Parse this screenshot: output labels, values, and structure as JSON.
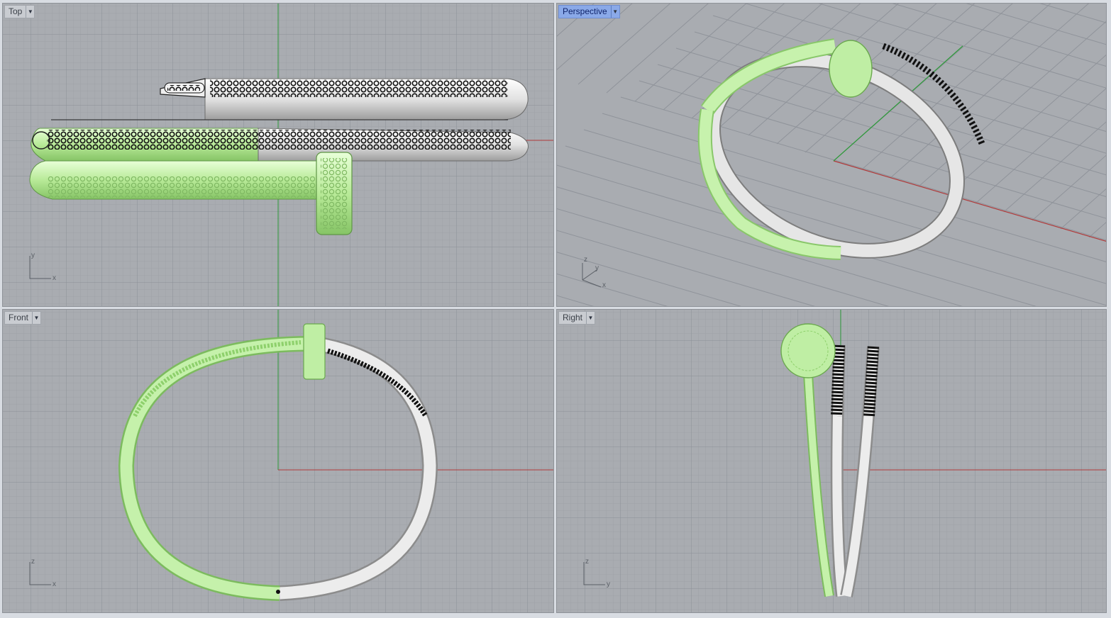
{
  "viewports": {
    "top": {
      "label": "Top",
      "active": false,
      "axis": {
        "vertical": "y",
        "horizontal": "x"
      }
    },
    "perspective": {
      "label": "Perspective",
      "active": true,
      "axis": {
        "vertical": "z",
        "depth": "y",
        "horizontal": "x"
      }
    },
    "front": {
      "label": "Front",
      "active": false,
      "axis": {
        "vertical": "z",
        "horizontal": "x"
      }
    },
    "right": {
      "label": "Right",
      "active": false,
      "axis": {
        "vertical": "z",
        "horizontal": "y"
      }
    }
  },
  "icons": {
    "viewport_menu": "dropdown-arrow-icon"
  },
  "colors": {
    "viewport_bg": "#a9acb1",
    "grid_minor": "#9ea2a8",
    "grid_major": "#8b9096",
    "x_axis": "#b03a3a",
    "y_axis": "#2e9a3a",
    "selected_green": "#c2f0a8",
    "metal_silver": "#e4e4e4",
    "pave_black": "#1a1a1a",
    "active_tab": "#8aa9e8"
  }
}
